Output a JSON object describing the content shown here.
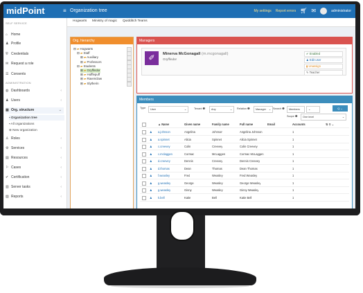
{
  "app": {
    "logo": "midPoint",
    "menu_icon": "≡",
    "page_title": "Organization tree",
    "top_links": [
      "My settings",
      "Report errors"
    ],
    "user_name": "administrator"
  },
  "sidebar": {
    "head_self": "SELF SERVICE",
    "self_items": [
      {
        "label": "Home",
        "icon": "home-icon",
        "glyph": "⌂"
      },
      {
        "label": "Profile",
        "icon": "user-icon",
        "glyph": "♟"
      },
      {
        "label": "Credentials",
        "icon": "shield-icon",
        "glyph": "⛨"
      },
      {
        "label": "Request a role",
        "icon": "cart-icon",
        "glyph": "✉"
      },
      {
        "label": "Consents",
        "icon": "list-icon",
        "glyph": "☰"
      }
    ],
    "head_admin": "ADMINISTRATION",
    "admin_items": [
      {
        "label": "Dashboards",
        "icon": "dashboard-icon",
        "glyph": "◍"
      },
      {
        "label": "Users",
        "icon": "users-icon",
        "glyph": "♟"
      },
      {
        "label": "Org. structure",
        "icon": "org-icon",
        "glyph": "▦"
      }
    ],
    "org_sub": [
      "Organization tree",
      "All organizations",
      "New organization"
    ],
    "more_items": [
      {
        "label": "Roles",
        "icon": "roles-icon",
        "glyph": "♙"
      },
      {
        "label": "Services",
        "icon": "services-icon",
        "glyph": "⚙"
      },
      {
        "label": "Resources",
        "icon": "resources-icon",
        "glyph": "▤"
      },
      {
        "label": "Cases",
        "icon": "cases-icon",
        "glyph": "⚐"
      },
      {
        "label": "Certification",
        "icon": "certification-icon",
        "glyph": "✔"
      },
      {
        "label": "Server tasks",
        "icon": "tasks-icon",
        "glyph": "▥"
      },
      {
        "label": "Reports",
        "icon": "reports-icon",
        "glyph": "▧"
      }
    ]
  },
  "tabs": [
    "Hogwarts",
    "Ministry of magic",
    "Quidditch Teams"
  ],
  "tree": {
    "title": "Org. hierarchy",
    "nodes": [
      {
        "label": "Hogwarts",
        "indent": 0,
        "exp": "⊟"
      },
      {
        "label": "Staff",
        "indent": 1,
        "exp": "⊟"
      },
      {
        "label": "Auxiliary",
        "indent": 2,
        "exp": "⊞"
      },
      {
        "label": "Professors",
        "indent": 2,
        "exp": "⊞"
      },
      {
        "label": "Students",
        "indent": 1,
        "exp": "⊟"
      },
      {
        "label": "Gryffindor",
        "indent": 2,
        "exp": "⊞",
        "selected": true
      },
      {
        "label": "Hufflepuff",
        "indent": 2,
        "exp": "⊞"
      },
      {
        "label": "Ravenclaw",
        "indent": 2,
        "exp": "⊞"
      },
      {
        "label": "Slytherin",
        "indent": 2,
        "exp": "⊞"
      }
    ]
  },
  "managers": {
    "title": "Managers",
    "name": "Minerva McGonagall",
    "username": "(m.mcgonagall)",
    "org": "Gryffindor",
    "actions": [
      "Enabled",
      "Edit user",
      "Unassign",
      "Teacher"
    ]
  },
  "members": {
    "title": "Members",
    "filters": {
      "type_label": "Type",
      "type_value": "User",
      "tenant_label": "Tenant",
      "tenant_value": "Any",
      "relation_label": "Relation",
      "relation_value": "Manager",
      "search_label": "Search",
      "search_value": "Members",
      "scope_label": "Scope",
      "scope_value": "One level",
      "search_btn": "Q"
    },
    "columns": [
      "",
      "",
      "Name",
      "Given name",
      "Family name",
      "Full name",
      "Email",
      "Accounts",
      ""
    ],
    "rows": [
      {
        "name": "a.johnson",
        "given": "Angelina",
        "family": "Johnson",
        "full": "Angelina Johnson",
        "accounts": "1"
      },
      {
        "name": "a.spinnet",
        "given": "Alicia",
        "family": "Spinnet",
        "full": "Alicia Spinnet",
        "accounts": "1"
      },
      {
        "name": "c.creevey",
        "given": "Colin",
        "family": "Creevey",
        "full": "Colin Creevey",
        "accounts": "1"
      },
      {
        "name": "c.mclaggen",
        "given": "Cormac",
        "family": "McLaggen",
        "full": "Cormac McLaggen",
        "accounts": "1"
      },
      {
        "name": "d.creevey",
        "given": "Dennis",
        "family": "Creevey",
        "full": "Dennis Creevey",
        "accounts": "1"
      },
      {
        "name": "d.thomas",
        "given": "Dean",
        "family": "Thomas",
        "full": "Dean Thomas",
        "accounts": "1"
      },
      {
        "name": "f.weasley",
        "given": "Fred",
        "family": "Weasley",
        "full": "Fred Weasley",
        "accounts": "1"
      },
      {
        "name": "g.weasley",
        "given": "George",
        "family": "Weasley",
        "full": "George Weasley",
        "accounts": "1"
      },
      {
        "name": "g.weasley",
        "given": "Ginny",
        "family": "Weasley",
        "full": "Ginny Weasley",
        "accounts": "1"
      },
      {
        "name": "k.bell",
        "given": "Katie",
        "family": "Bell",
        "full": "Katie Bell",
        "accounts": "1"
      }
    ]
  }
}
